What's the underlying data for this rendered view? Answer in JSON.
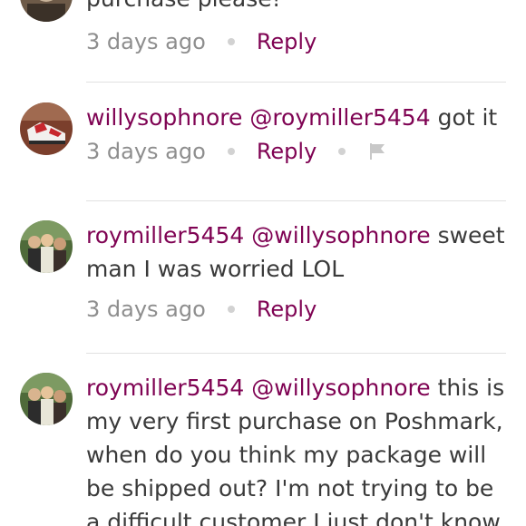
{
  "comments": [
    {
      "text_tail": "purchase please!",
      "time": "3 days ago",
      "reply_label": "Reply"
    },
    {
      "username": "willysophnore",
      "mention": "@roymiller5454",
      "text": " got it",
      "time": "3 days ago",
      "reply_label": "Reply",
      "avatar_icon": "sneaker-avatar-icon",
      "flag_icon": "flag-icon"
    },
    {
      "username": "roymiller5454",
      "mention": "@willysophnore",
      "text": " sweet man I was worried LOL",
      "time": "3 days ago",
      "reply_label": "Reply",
      "avatar_icon": "group-photo-avatar-icon"
    },
    {
      "username": "roymiller5454",
      "mention": "@willysophnore",
      "text": " this is my very first purchase on Poshmark, when do you think my package will be shipped out? I'm not trying to be a difficult customer I just don't know",
      "avatar_icon": "group-photo-avatar-icon"
    }
  ],
  "colors": {
    "brand": "#7f0353",
    "text": "#3a3a3a",
    "muted": "#8e8e8e",
    "divider": "#e1e1e1"
  }
}
